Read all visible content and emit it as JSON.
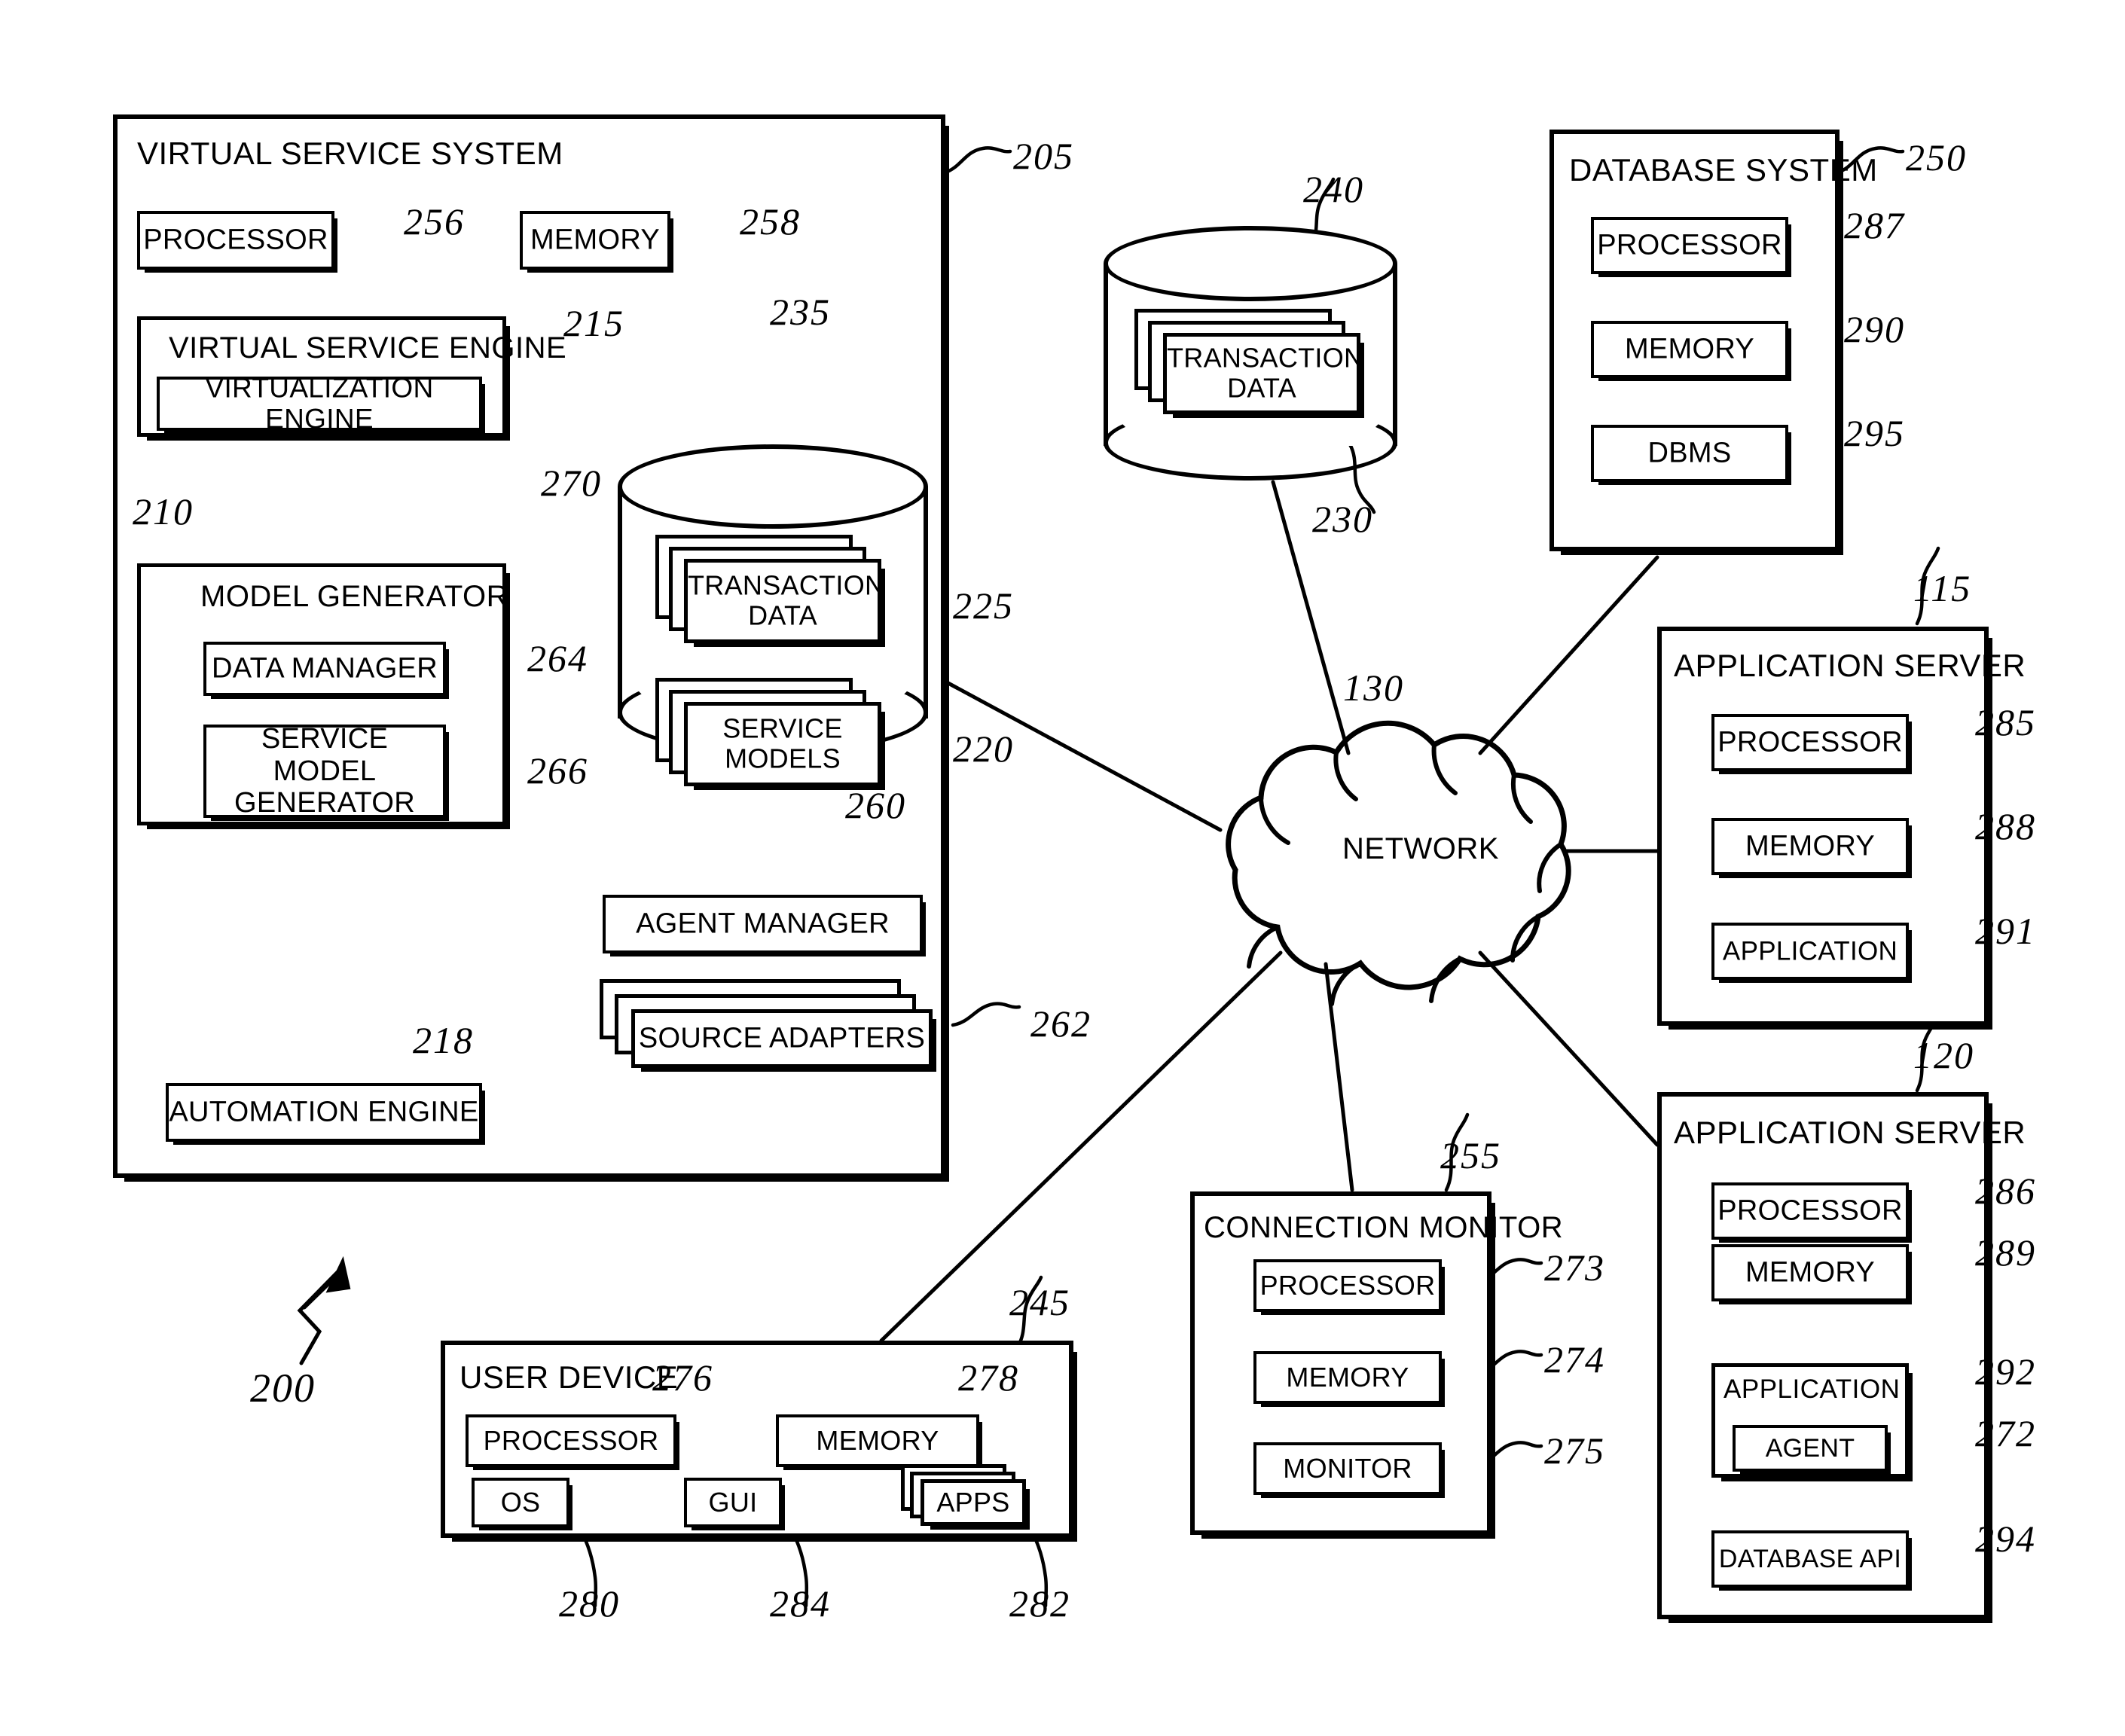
{
  "figure": {
    "number": "200",
    "network_label": "NETWORK",
    "network_ref": "130"
  },
  "virtual_service_system": {
    "title": "VIRTUAL SERVICE SYSTEM",
    "ref": "205",
    "processor": {
      "label": "PROCESSOR",
      "ref": "256"
    },
    "memory": {
      "label": "MEMORY",
      "ref": "258"
    },
    "virtual_service_engine": {
      "label": "VIRTUAL SERVICE ENGINE",
      "ref": "215"
    },
    "virtualization_engine": {
      "label": "VIRTUALIZATION ENGINE",
      "ref": "270"
    },
    "model_generator": {
      "label": "MODEL GENERATOR",
      "ref": "210"
    },
    "data_manager": {
      "label": "DATA MANAGER",
      "ref": "264"
    },
    "service_model_generator": {
      "label": "SERVICE MODEL GENERATOR",
      "line1": "SERVICE MODEL",
      "line2": "GENERATOR",
      "ref": "266"
    },
    "automation_engine": {
      "label": "AUTOMATION ENGINE",
      "ref": "218"
    },
    "agent_manager": {
      "label": "AGENT MANAGER",
      "ref": "260"
    },
    "source_adapters": {
      "label": "SOURCE ADAPTERS",
      "ref": "262"
    },
    "datastore": {
      "ref": "235",
      "transaction_data": {
        "line1": "TRANSACTION",
        "line2": "DATA",
        "ref": "225"
      },
      "service_models": {
        "line1": "SERVICE",
        "line2": "MODELS",
        "ref": "220"
      }
    }
  },
  "transaction_data_store": {
    "ref": "240",
    "cards": {
      "line1": "TRANSACTION",
      "line2": "DATA",
      "ref": "230"
    }
  },
  "database_system": {
    "title": "DATABASE SYSTEM",
    "ref": "250",
    "items": [
      {
        "label": "PROCESSOR",
        "ref": "287"
      },
      {
        "label": "MEMORY",
        "ref": "290"
      },
      {
        "label": "DBMS",
        "ref": "295"
      }
    ]
  },
  "application_server_1": {
    "title": "APPLICATION SERVER",
    "ref": "115",
    "items": [
      {
        "label": "PROCESSOR",
        "ref": "285"
      },
      {
        "label": "MEMORY",
        "ref": "288"
      },
      {
        "label": "APPLICATION",
        "ref": "291"
      }
    ]
  },
  "application_server_2": {
    "title": "APPLICATION SERVER",
    "ref": "120",
    "processor": {
      "label": "PROCESSOR",
      "ref": "286"
    },
    "memory": {
      "label": "MEMORY",
      "ref": "289"
    },
    "application": {
      "label": "APPLICATION",
      "ref": "292"
    },
    "agent": {
      "label": "AGENT",
      "ref": "272"
    },
    "database_api": {
      "label": "DATABASE API",
      "ref": "294"
    }
  },
  "connection_monitor": {
    "title": "CONNECTION MONITOR",
    "ref": "255",
    "items": [
      {
        "label": "PROCESSOR",
        "ref": "273"
      },
      {
        "label": "MEMORY",
        "ref": "274"
      },
      {
        "label": "MONITOR",
        "ref": "275"
      }
    ]
  },
  "user_device": {
    "title": "USER DEVICE",
    "ref": "245",
    "processor": {
      "label": "PROCESSOR",
      "ref": "276"
    },
    "memory": {
      "label": "MEMORY",
      "ref": "278"
    },
    "os": {
      "label": "OS",
      "ref": "280"
    },
    "gui": {
      "label": "GUI",
      "ref": "284"
    },
    "apps": {
      "label": "APPS",
      "ref": "282"
    }
  }
}
